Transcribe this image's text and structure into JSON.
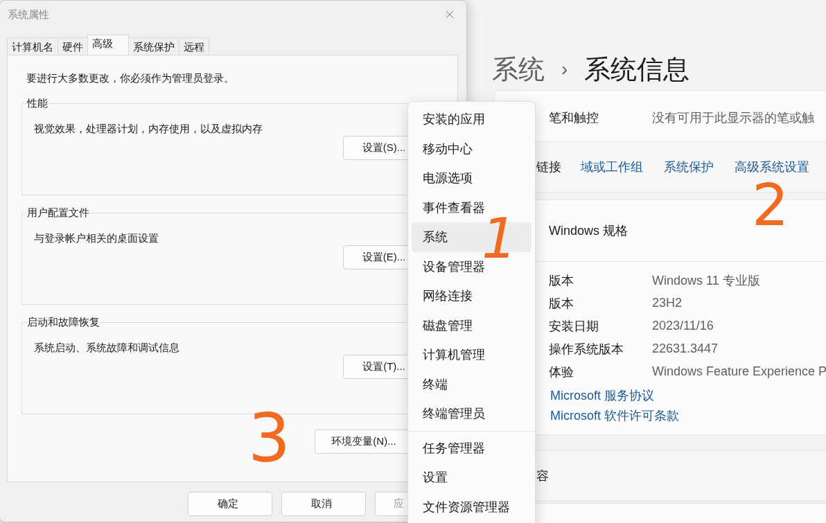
{
  "dialog": {
    "title": "系统属性",
    "tabs": [
      {
        "label": "计算机名",
        "selected": false
      },
      {
        "label": "硬件",
        "selected": false
      },
      {
        "label": "高级",
        "selected": true
      },
      {
        "label": "系统保护",
        "selected": false
      },
      {
        "label": "远程",
        "selected": false
      }
    ],
    "notice": "要进行大多数更改，你必须作为管理员登录。",
    "groups": [
      {
        "title": "性能",
        "description": "视觉效果，处理器计划，内存使用，以及虚拟内存",
        "button": "设置(S)..."
      },
      {
        "title": "用户配置文件",
        "description": "与登录帐户相关的桌面设置",
        "button": "设置(E)..."
      },
      {
        "title": "启动和故障恢复",
        "description": "系统启动、系统故障和调试信息",
        "button": "设置(T)..."
      }
    ],
    "env_button": "环境变量(N)...",
    "buttons": [
      {
        "label": "确定",
        "disabled": false
      },
      {
        "label": "取消",
        "disabled": false
      },
      {
        "label": "应",
        "disabled": true
      }
    ]
  },
  "settings": {
    "breadcrumb": {
      "parent": "系统",
      "separator": "›",
      "current": "系统信息"
    },
    "top_rows": [
      {
        "label": "笔和触控",
        "value": "没有可用于此显示器的笔或触"
      }
    ],
    "related": {
      "label": "链接",
      "links": [
        "域或工作组",
        "系统保护",
        "高级系统设置"
      ]
    },
    "spec": {
      "title": "Windows 规格",
      "rows": [
        {
          "label": "版本",
          "value": "Windows 11 专业版"
        },
        {
          "label": "版本",
          "value": "23H2"
        },
        {
          "label": "安装日期",
          "value": "2023/11/16"
        },
        {
          "label": "操作系统版本",
          "value": "22631.3447"
        },
        {
          "label": "体验",
          "value": "Windows Feature Experience P"
        }
      ],
      "links": [
        "Microsoft 服务协议",
        "Microsoft 软件许可条款"
      ]
    },
    "next_section": {
      "title": "容"
    }
  },
  "context_menu": {
    "groups": [
      [
        {
          "label": "安装的应用",
          "selected": false
        },
        {
          "label": "移动中心",
          "selected": false
        },
        {
          "label": "电源选项",
          "selected": false
        },
        {
          "label": "事件查看器",
          "selected": false
        },
        {
          "label": "系统",
          "selected": true
        },
        {
          "label": "设备管理器",
          "selected": false
        },
        {
          "label": "网络连接",
          "selected": false
        },
        {
          "label": "磁盘管理",
          "selected": false
        },
        {
          "label": "计算机管理",
          "selected": false
        },
        {
          "label": "终端",
          "selected": false
        },
        {
          "label": "终端管理员",
          "selected": false
        }
      ],
      [
        {
          "label": "任务管理器",
          "selected": false
        },
        {
          "label": "设置",
          "selected": false
        },
        {
          "label": "文件资源管理器",
          "selected": false
        }
      ]
    ]
  },
  "annotations": [
    "1",
    "2",
    "3"
  ]
}
